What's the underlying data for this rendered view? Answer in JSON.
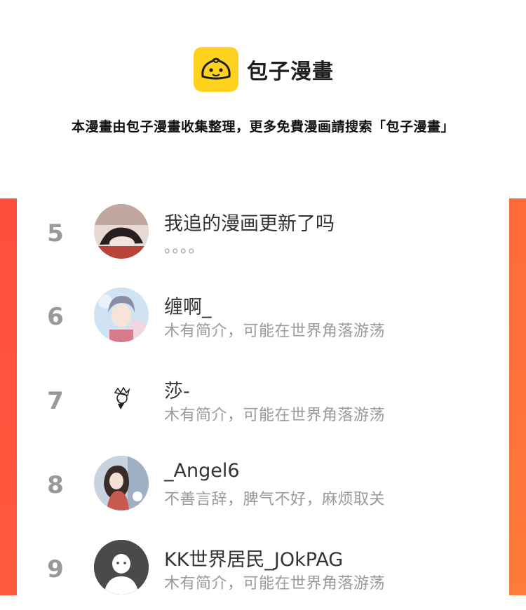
{
  "brand": {
    "name": "包子漫畫",
    "logo_icon": "bun-logo-icon",
    "logo_color": "#ffd21e"
  },
  "notice": "本漫畫由包子漫畫收集整理，更多免費漫画請搜索「包子漫畫」",
  "accent": {
    "left": "#ff4e3c",
    "right": "#ff7b3a"
  },
  "ranking": [
    {
      "rank": "5",
      "name": "我追的漫画更新了吗",
      "bio": "。。。。",
      "avatar": "anime-sleeping-avatar"
    },
    {
      "rank": "6",
      "name": "缠啊_",
      "bio": "木有简介，可能在世界角落游荡",
      "avatar": "anime-boy-avatar"
    },
    {
      "rank": "7",
      "name": "莎-",
      "bio": "木有简介，可能在世界角落游荡",
      "avatar": "sketch-avatar"
    },
    {
      "rank": "8",
      "name": "_Angel6",
      "bio": "不善言辞，脾气不好，麻烦取关",
      "avatar": "anime-girl-avatar"
    },
    {
      "rank": "9",
      "name": "KK世界居民_JOkPAG",
      "bio": "木有简介，可能在世界角落游荡",
      "avatar": "default-user-avatar"
    }
  ]
}
